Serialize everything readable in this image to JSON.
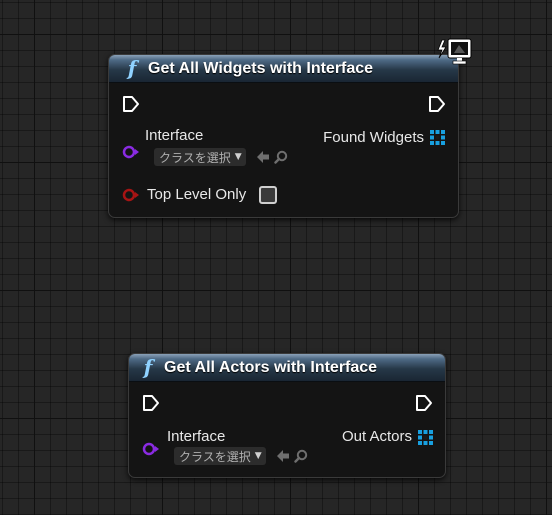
{
  "colors": {
    "function_icon": "#8fd2ff",
    "interface_pin": "#8a2be2",
    "bool_pin": "#a81414",
    "array_pin": "#18a0e0",
    "exec_pin": "#ffffff"
  },
  "icons": {
    "function": "f",
    "context": "widget-context-icon",
    "back_arrow": "arrow-left-icon",
    "browse": "magnifier-icon",
    "array": "array-grid-icon"
  },
  "nodes": [
    {
      "title": "Get All Widgets with Interface",
      "inputs": {
        "interface_label": "Interface",
        "class_select": "クラスを選択",
        "top_level_label": "Top Level Only",
        "top_level_checked": false
      },
      "outputs": {
        "found_label": "Found Widgets"
      }
    },
    {
      "title": "Get All Actors with Interface",
      "inputs": {
        "interface_label": "Interface",
        "class_select": "クラスを選択"
      },
      "outputs": {
        "out_label": "Out Actors"
      }
    }
  ]
}
